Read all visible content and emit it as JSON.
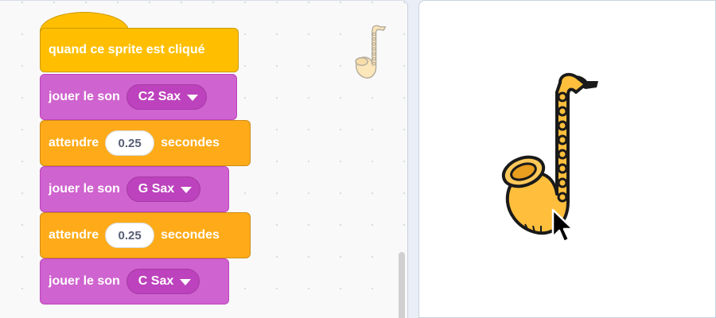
{
  "code_area": {
    "blocks": [
      {
        "type": "event",
        "text": "quand ce sprite est cliqué"
      },
      {
        "type": "sound",
        "text": "jouer le son",
        "sound": "C2 Sax"
      },
      {
        "type": "wait",
        "text_before": "attendre",
        "value": "0.25",
        "text_after": "secondes"
      },
      {
        "type": "sound",
        "text": "jouer le son",
        "sound": "G Sax"
      },
      {
        "type": "wait",
        "text_before": "attendre",
        "value": "0.25",
        "text_after": "secondes"
      },
      {
        "type": "sound",
        "text": "jouer le son",
        "sound": "C Sax"
      }
    ],
    "sprite_thumbnail_icon": "saxophone-icon"
  },
  "stage": {
    "sprite_icon": "saxophone-icon",
    "cursor_icon": "arrow-cursor-icon"
  },
  "colors": {
    "events": "#ffbf00",
    "sound": "#cf63cf",
    "control": "#ffab19",
    "sax_body": "#ffbf3c"
  }
}
